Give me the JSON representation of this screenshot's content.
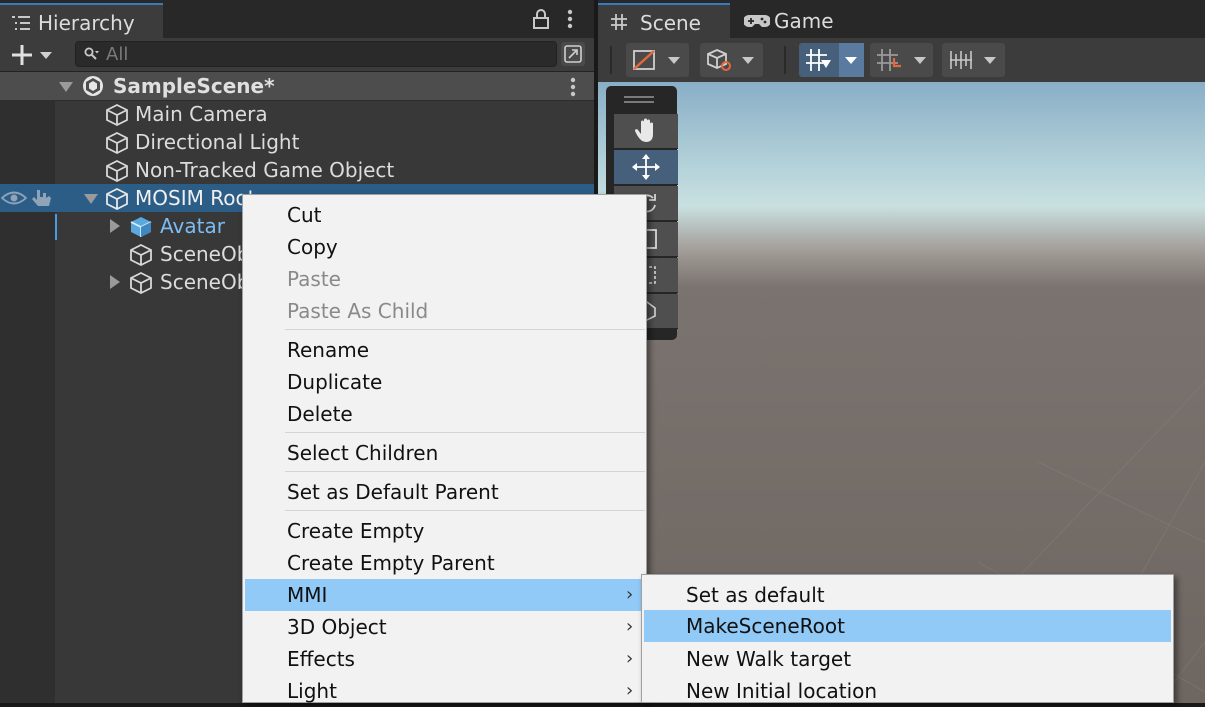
{
  "hierarchy": {
    "tab_label": "Hierarchy",
    "search_placeholder": "All",
    "scene_name": "SampleScene*",
    "rows": [
      {
        "label": "Main Camera"
      },
      {
        "label": "Directional Light"
      },
      {
        "label": "Non-Tracked Game Object"
      },
      {
        "label": "MOSIM Root",
        "selected": true
      },
      {
        "label": "Avatar",
        "icon": "prefab-cube-icon"
      },
      {
        "label": "SceneOb"
      },
      {
        "label": "SceneOb"
      }
    ]
  },
  "scene_view": {
    "tabs": [
      {
        "label": "Scene",
        "icon": "grid-icon",
        "active": true
      },
      {
        "label": "Game",
        "icon": "gamepad-icon"
      }
    ]
  },
  "context_menu": {
    "items": [
      {
        "label": "Cut"
      },
      {
        "label": "Copy"
      },
      {
        "label": "Paste",
        "disabled": true
      },
      {
        "label": "Paste As Child",
        "disabled": true
      },
      {
        "label": "Rename"
      },
      {
        "label": "Duplicate"
      },
      {
        "label": "Delete"
      },
      {
        "label": "Select Children"
      },
      {
        "label": "Set as Default Parent"
      },
      {
        "label": "Create Empty"
      },
      {
        "label": "Create Empty Parent"
      },
      {
        "label": "MMI",
        "submenu": true,
        "highlighted": true
      },
      {
        "label": "3D Object",
        "submenu": true
      },
      {
        "label": "Effects",
        "submenu": true
      },
      {
        "label": "Light",
        "submenu": true
      }
    ],
    "submenu_glyph": "›"
  },
  "mmi_submenu": {
    "items": [
      {
        "label": "Set as default"
      },
      {
        "label": "MakeSceneRoot",
        "highlighted": true
      },
      {
        "label": "New Walk target"
      },
      {
        "label": "New Initial location"
      }
    ]
  },
  "colors": {
    "selection": "#2c5d87",
    "menu_highlight": "#91c9f7",
    "accent": "#3a79bb"
  }
}
